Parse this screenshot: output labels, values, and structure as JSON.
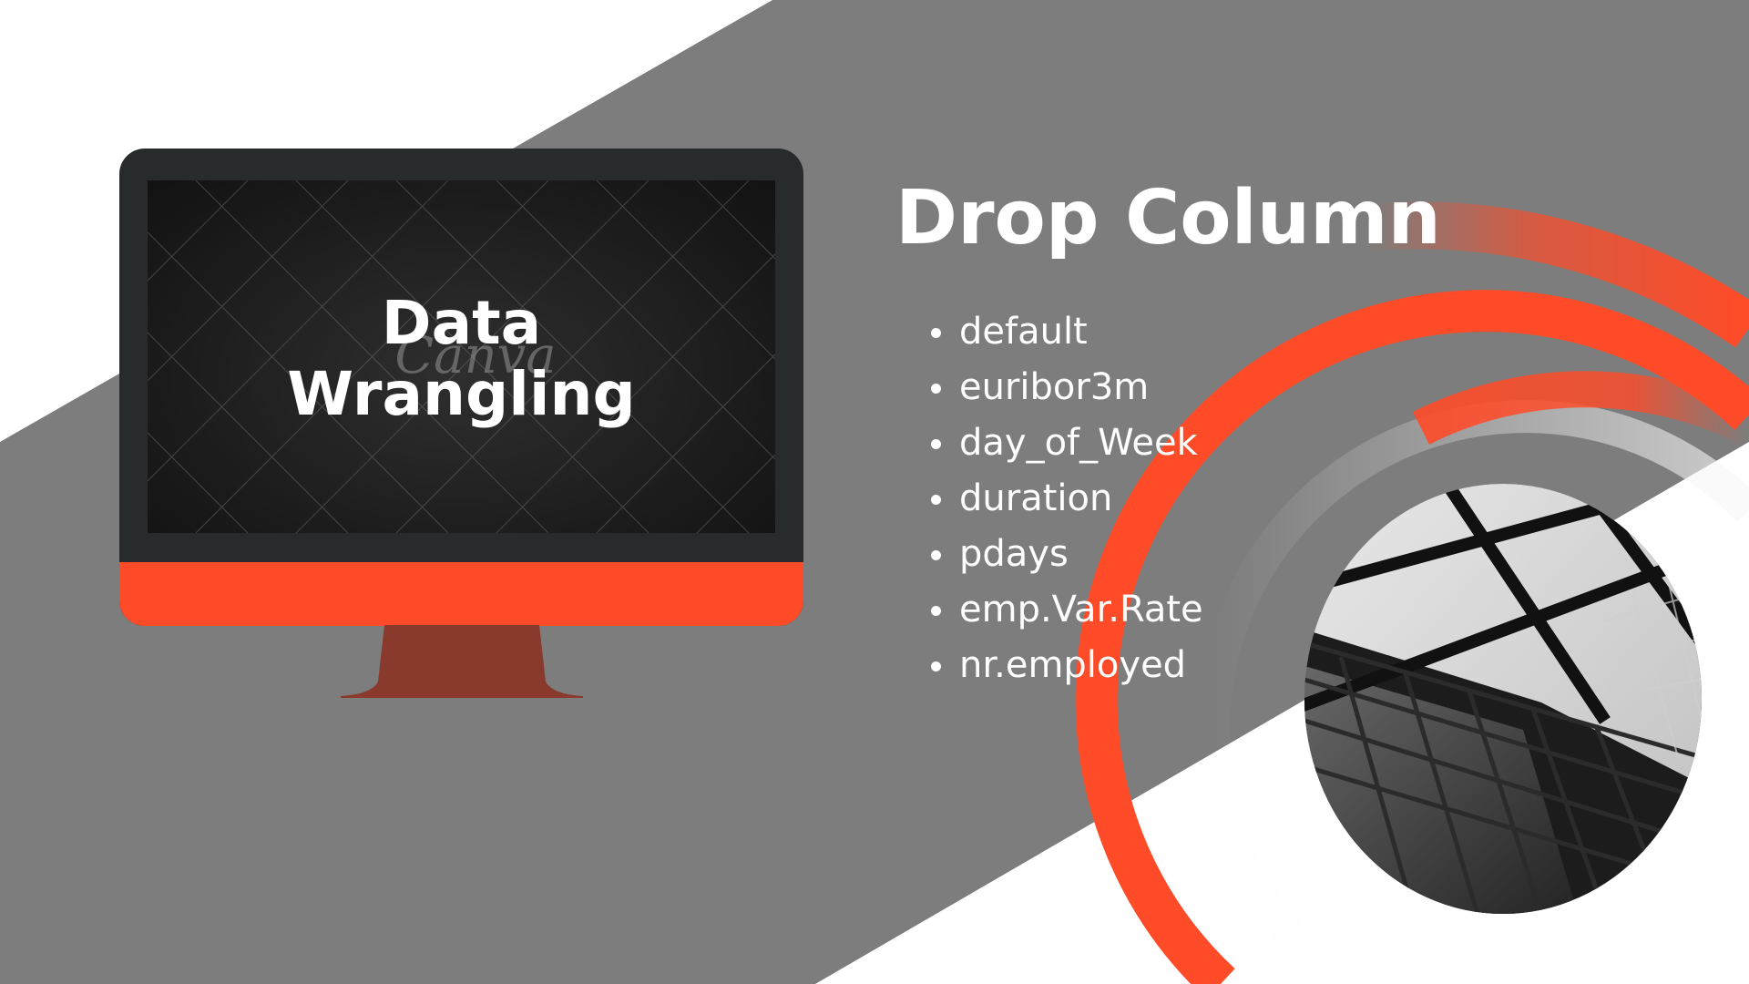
{
  "colors": {
    "background": "#ffffff",
    "gray_band": "#7c7d7c",
    "accent_orange": "#ff4b28",
    "stand_brown": "#8a3a2c",
    "monitor_dark": "#272b2c"
  },
  "monitor": {
    "screen_title": "Data\nWrangling",
    "watermark": "Canva"
  },
  "slide": {
    "heading": "Drop Column",
    "columns": [
      "default",
      "euribor3m",
      "day_of_Week",
      "duration",
      "pdays",
      "emp.Var.Rate",
      "nr.employed"
    ]
  },
  "icons": {
    "monitor": "desktop-monitor-icon",
    "photo": "building-glass-photo"
  }
}
